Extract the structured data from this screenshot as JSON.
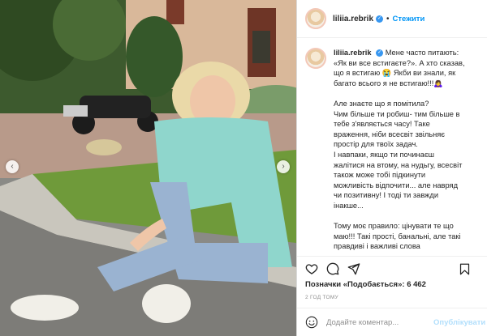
{
  "post": {
    "username": "liliia.rebrik",
    "follow_label": "Стежити",
    "separator": "•",
    "caption_lines": [
      "Мене часто питають:",
      "«Як ви все встигаєте?». А хто сказав,",
      "що я встигаю 😭 Якби ви знали, як",
      "багато всього я не встигаю!!!🙇‍♀️",
      "",
      "Але знаєте що я помітила?",
      "Чим більше ти робиш- тим більше в",
      "тебе з'являється часу! Таке",
      "враження, ніби всесвіт звільняє",
      "простір для твоїх задач.",
      "І навпаки, якщо ти починаєш",
      "жалітися на втому, на нудьгу, всесвіт",
      "також може тобі підкинути",
      "можливість відпочити... але навряд",
      "чи позитивну! І тоді ти завжди",
      "інакше...",
      "",
      "Тому моє правило: цінувати те що",
      "маю!!! Такі прості, банальні, але такі",
      "правдиві і важливі слова"
    ],
    "likes_text": "Позначки «Подобається»: 6 462",
    "time_ago": "2 ГОД ТОМУ",
    "comment_placeholder": "Додайте коментар...",
    "publish_label": "Опублікувати",
    "nav_prev": "‹",
    "nav_next": "›",
    "icons": {
      "like": "heart-icon",
      "comment": "comment-icon",
      "share": "share-icon",
      "save": "bookmark-icon",
      "emoji": "emoji-icon",
      "verified": "verified-icon"
    },
    "colors": {
      "accent": "#0095f6",
      "verified": "#3897f0",
      "publish_disabled": "#b2dffc",
      "muted": "#8e8e8e"
    }
  }
}
